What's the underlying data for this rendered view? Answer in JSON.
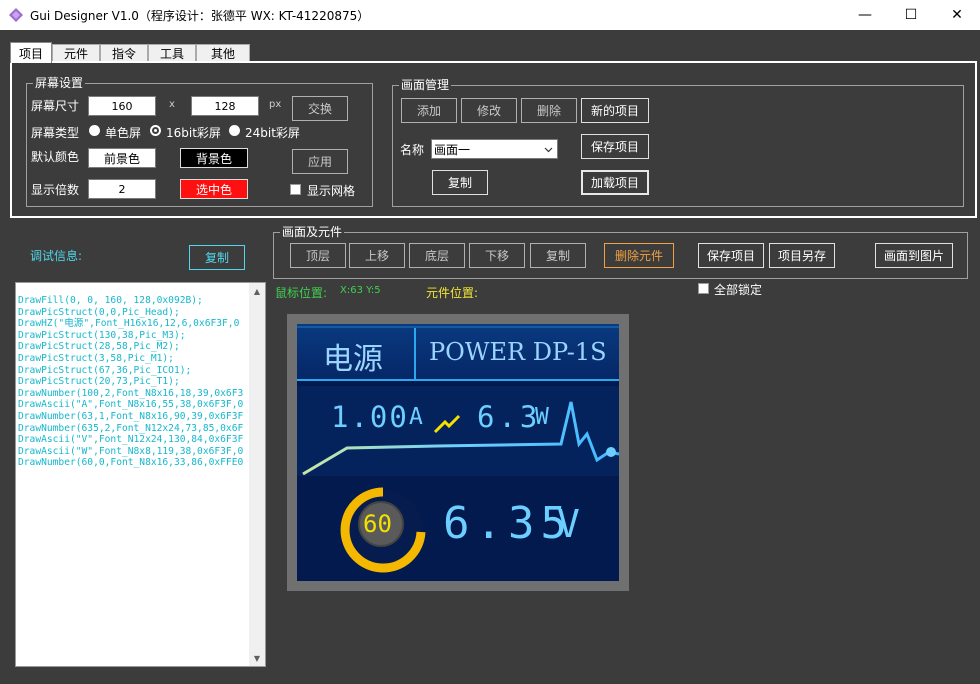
{
  "window": {
    "title": "Gui Designer V1.0（程序设计：张德平 WX: KT-41220875）",
    "minimize": "—",
    "maximize": "☐",
    "close": "✕"
  },
  "tabs": [
    {
      "label": "项目"
    },
    {
      "label": "元件"
    },
    {
      "label": "指令"
    },
    {
      "label": "工具"
    },
    {
      "label": "其他"
    }
  ],
  "screen_settings": {
    "title": "屏幕设置",
    "size_label": "屏幕尺寸",
    "width": "160",
    "x_sep": "x",
    "height": "128",
    "px": "px",
    "swap_button": "交换",
    "type_label": "屏幕类型",
    "type_options": [
      "单色屏",
      "16bit彩屏",
      "24bit彩屏"
    ],
    "type_selected": "16bit彩屏",
    "color_label": "默认颜色",
    "fg_button": "前景色",
    "bg_button": "背景色",
    "apply_button": "应用",
    "scale_label": "显示倍数",
    "scale": "2",
    "selected_color_button": "选中色",
    "show_grid_label": "显示网格"
  },
  "screen_manage": {
    "title": "画面管理",
    "add_button": "添加",
    "modify_button": "修改",
    "delete_button": "删除",
    "new_project_button": "新的项目",
    "name_label": "名称",
    "name_value": "画面一",
    "save_project_button": "保存项目",
    "copy_button": "复制",
    "load_project_button": "加载项目"
  },
  "elements_bar": {
    "title": "画面及元件",
    "top_button": "顶层",
    "up_button": "上移",
    "bottom_button": "底层",
    "down_button": "下移",
    "copy_button": "复制",
    "delete_element_button": "删除元件",
    "save_project_button": "保存项目",
    "save_as_button": "项目另存",
    "screen_to_image_button": "画面到图片",
    "lock_all_label": "全部锁定"
  },
  "status": {
    "mouse_label": "鼠标位置:",
    "mouse_value": "X:63 Y:5",
    "element_label": "元件位置:"
  },
  "debug": {
    "title": "调试信息:",
    "copy_button": "复制",
    "lines": [
      "DrawFill(0, 0, 160, 128,0x092B);",
      "DrawPicStruct(0,0,Pic_Head);",
      "DrawHZ(\"电源\",Font_H16x16,12,6,0x6F3F,0",
      "DrawPicStruct(130,38,Pic_M3);",
      "DrawPicStruct(28,58,Pic_M2);",
      "DrawPicStruct(3,58,Pic_M1);",
      "DrawPicStruct(67,36,Pic_ICO1);",
      "DrawPicStruct(20,73,Pic_T1);",
      "DrawNumber(100,2,Font_N8x16,18,39,0x6F3",
      "DrawAscii(\"A\",Font_N8x16,55,38,0x6F3F,0",
      "DrawNumber(63,1,Font_N8x16,90,39,0x6F3F",
      "DrawNumber(635,2,Font_N12x24,73,85,0x6F",
      "DrawAscii(\"V\",Font_N12x24,130,84,0x6F3F",
      "DrawAscii(\"W\",Font_N8x8,119,38,0x6F3F,0",
      "DrawNumber(60,0,Font_N8x16,33,86,0xFFE0"
    ]
  },
  "preview": {
    "header_left": "电源",
    "header_right": "POWER DP-1S",
    "current": "1.00",
    "current_unit": "A",
    "power": "6.3",
    "power_unit": "W",
    "gauge_value": "60",
    "voltage": "6.35",
    "voltage_unit": "V"
  },
  "colors": {
    "accent_cyan": "#4fd8ea",
    "accent_orange": "#f0a040",
    "selected_red": "#ff1010",
    "lcd_bg": "#031a4e",
    "lcd_text": "#6ccfff",
    "gauge_yellow": "#f5c400"
  }
}
